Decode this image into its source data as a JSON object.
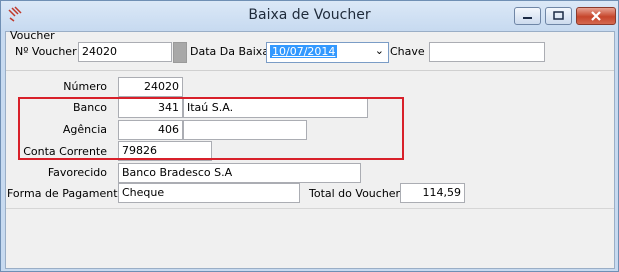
{
  "window": {
    "title": "Baixa de Voucher"
  },
  "voucher_group": {
    "legend": "Voucher",
    "voucher_label": "Nº Voucher",
    "voucher_value": "24020",
    "date_label": "Data Da Baixa :",
    "date_value": "10/07/2014",
    "key_label": "Chave :",
    "key_value": ""
  },
  "details": {
    "numero_label": "Número",
    "numero_value": "24020",
    "banco_label": "Banco",
    "banco_code": "341",
    "banco_name": "Itaú S.A.",
    "agencia_label": "Agência",
    "agencia_code": "406",
    "agencia_name": "",
    "conta_label": "Conta Corrente",
    "conta_value": "79826",
    "favorecido_label": "Favorecido",
    "favorecido_value": "Banco Bradesco S.A",
    "forma_label": "Forma de Pagamento",
    "forma_value": "Cheque",
    "total_label": "Total do Voucher",
    "total_value": "114,59"
  },
  "colors": {
    "highlight": "#d8202a",
    "selection": "#3399ff"
  }
}
